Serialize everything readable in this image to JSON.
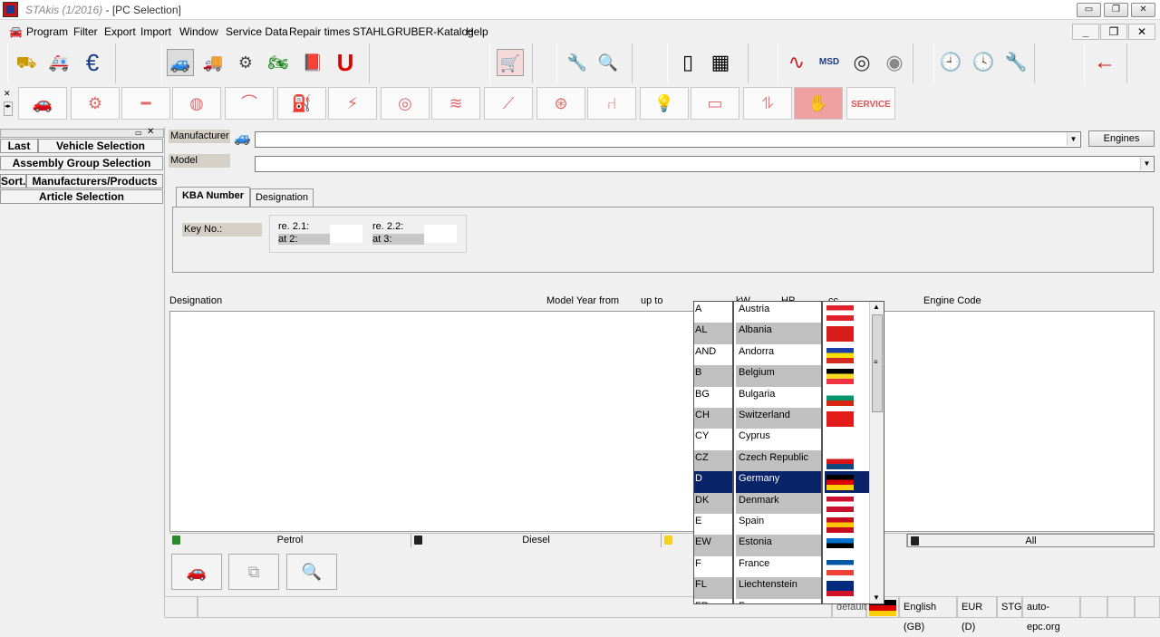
{
  "window": {
    "app_name": "STAkis (1/2016)",
    "doc_title": "- [PC Selection]",
    "controls": {
      "minimize": "▭",
      "restore": "❐",
      "close": "✕"
    }
  },
  "menu": [
    "Program",
    "Filter",
    "Export",
    "Import",
    "Window",
    "Service Data",
    "Repair times",
    "STAHLGRUBER-Katalog",
    "Help"
  ],
  "mdi_controls": {
    "minimize": "_",
    "restore": "❐",
    "close": "✕"
  },
  "toolbar_icons": [
    "forklift-icon",
    "ambulance-icon",
    "euro-icon",
    "car-icon",
    "truck-icon",
    "engine-icon",
    "motorbike-icon",
    "book-icon",
    "magnet-icon",
    "cart-icon",
    "vehicle-tools-icon",
    "car-search-icon",
    "split-view-icon",
    "grid-view-icon",
    "oscilloscope-icon",
    "msd-icon",
    "tire-icon",
    "cd-icon",
    "clock-search-icon",
    "clock-zoom-icon",
    "wrench-icon",
    "back-arrow-icon"
  ],
  "assembly_icons": [
    "car-body-icon",
    "pistons-icon",
    "driveshaft-icon",
    "brake-icon",
    "wiper-icon",
    "fuel-pump-icon",
    "spark-plug-icon",
    "clutch-icon",
    "exhaust-icon",
    "lever-icon",
    "steering-wheel-icon",
    "seat-icon",
    "bulb-icon",
    "battery-icon",
    "shock-absorber-icon",
    "hand-icon"
  ],
  "assembly_service_label": "SERVICE",
  "left_panel": {
    "last": "Last",
    "vehicle_selection": "Vehicle Selection",
    "assembly_group_selection": "Assembly Group Selection",
    "sort": "Sort.",
    "manufacturers_products": "Manufacturers/Products",
    "article_selection": "Article Selection"
  },
  "form": {
    "manufacturer_label": "Manufacturer",
    "manufacturer_value": "",
    "model_label": "Model",
    "model_value": "",
    "engines_button": "Engines"
  },
  "tabs": [
    "KBA Number",
    "Designation"
  ],
  "kba": {
    "key_no_label": "Key No.:",
    "re21": "re. 2.1:",
    "at2": "at 2:",
    "re22": "re. 2.2:",
    "at3": "at 3:"
  },
  "columns": {
    "designation": "Designation",
    "model_year_from": "Model Year from",
    "up_to": "up to",
    "kw": "kW",
    "hp": "HP",
    "cc": "cc",
    "engine_code": "Engine Code"
  },
  "fuel_tabs": [
    "Petrol",
    "Diesel",
    "",
    "All"
  ],
  "countries": [
    {
      "code": "A",
      "name": "Austria",
      "flag": [
        "#e0202a",
        "#ffffff",
        "#e0202a"
      ]
    },
    {
      "code": "AL",
      "name": "Albania",
      "flag": [
        "#d81b1b",
        "#d81b1b",
        "#d81b1b"
      ]
    },
    {
      "code": "AND",
      "name": "Andorra",
      "flag": [
        "#1c3faa",
        "#fedf00",
        "#d52b1e"
      ]
    },
    {
      "code": "B",
      "name": "Belgium",
      "flag": [
        "#000000",
        "#fdda24",
        "#ef3340"
      ]
    },
    {
      "code": "BG",
      "name": "Bulgaria",
      "flag": [
        "#ffffff",
        "#00966e",
        "#d62612"
      ]
    },
    {
      "code": "CH",
      "name": "Switzerland",
      "flag": [
        "#e41b1b",
        "#e41b1b",
        "#e41b1b"
      ]
    },
    {
      "code": "CY",
      "name": "Cyprus",
      "flag": [
        "#ffffff",
        "#ffffff",
        "#ffffff"
      ]
    },
    {
      "code": "CZ",
      "name": "Czech Republic",
      "flag": [
        "#ffffff",
        "#d7141a",
        "#11457e"
      ]
    },
    {
      "code": "D",
      "name": "Germany",
      "flag": [
        "#000000",
        "#dd0000",
        "#ffce00"
      ]
    },
    {
      "code": "DK",
      "name": "Denmark",
      "flag": [
        "#c8102e",
        "#ffffff",
        "#c8102e"
      ]
    },
    {
      "code": "E",
      "name": "Spain",
      "flag": [
        "#c60b1e",
        "#ffc400",
        "#c60b1e"
      ]
    },
    {
      "code": "EW",
      "name": "Estonia",
      "flag": [
        "#0072ce",
        "#000000",
        "#ffffff"
      ]
    },
    {
      "code": "F",
      "name": "France",
      "flag": [
        "#0055a4",
        "#ffffff",
        "#ef4135"
      ]
    },
    {
      "code": "FL",
      "name": "Liechtenstein",
      "flag": [
        "#002b7f",
        "#002b7f",
        "#ce1126"
      ]
    },
    {
      "code": "FR",
      "name": "Faroes",
      "flag": [
        "#ffffff",
        "#ef303e",
        "#005eb8"
      ]
    }
  ],
  "selected_country": "Germany",
  "status": {
    "profile": "default",
    "language": "English (GB)",
    "currency": "EUR (D)",
    "code": "STG",
    "site": "auto-epc.org"
  }
}
